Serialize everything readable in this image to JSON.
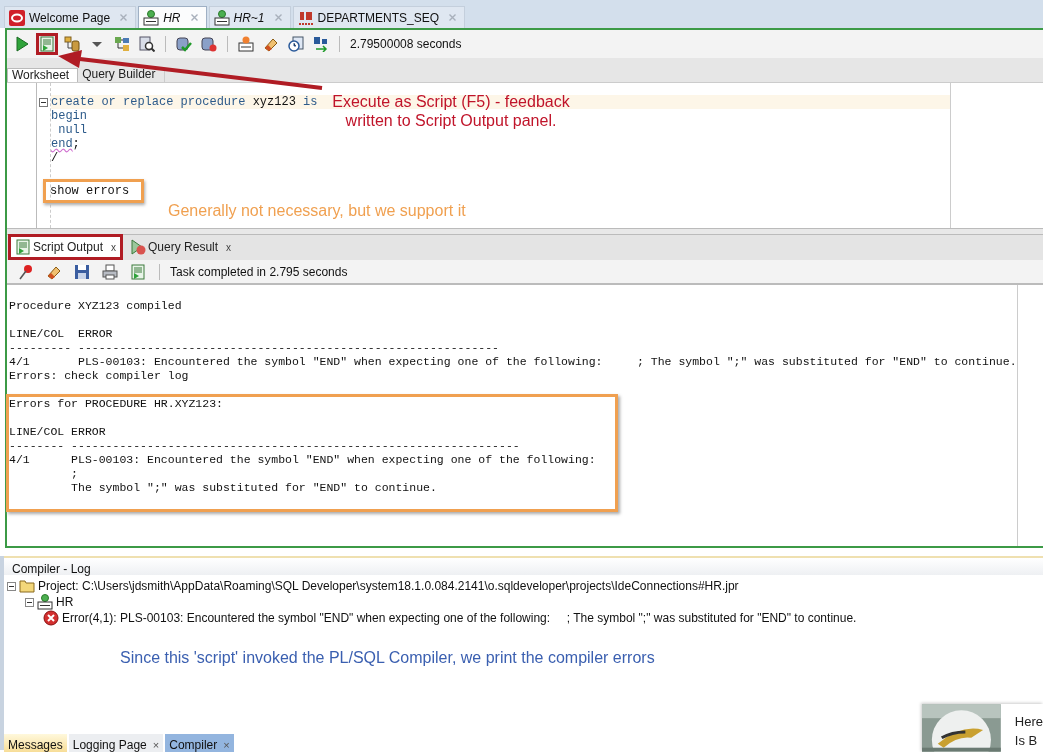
{
  "document_tabs": [
    {
      "label": "Welcome Page",
      "kind": "welcome",
      "italic": false,
      "selected": false
    },
    {
      "label": "HR",
      "kind": "worksheet",
      "italic": true,
      "selected": true
    },
    {
      "label": "HR~1",
      "kind": "worksheet",
      "italic": true,
      "selected": false
    },
    {
      "label": "DEPARTMENTS_SEQ",
      "kind": "sequence",
      "italic": false,
      "selected": false
    }
  ],
  "toolbar": {
    "groups": [
      [
        {
          "kind": "run",
          "highlighted": false
        },
        {
          "kind": "script",
          "highlighted": true
        },
        {
          "kind": "database",
          "highlighted": false
        },
        {
          "kind": "caret",
          "highlighted": false
        },
        {
          "kind": "tree",
          "highlighted": false
        },
        {
          "kind": "autotrace",
          "highlighted": false
        }
      ],
      [
        {
          "kind": "commit",
          "highlighted": false
        },
        {
          "kind": "rollback",
          "highlighted": false
        }
      ],
      [
        {
          "kind": "sqlfile",
          "highlighted": false
        },
        {
          "kind": "eraser",
          "highlighted": false
        },
        {
          "kind": "history",
          "highlighted": false
        },
        {
          "kind": "case",
          "highlighted": false
        }
      ]
    ],
    "elapsed": "2.79500008 seconds"
  },
  "editor_tabs": [
    {
      "label": "Worksheet",
      "selected": true
    },
    {
      "label": "Query Builder",
      "selected": false
    }
  ],
  "code_lines": [
    {
      "current": true,
      "highlighted": false,
      "segments": [
        {
          "text": "create or replace procedure ",
          "kind": "keyword"
        },
        {
          "text": "xyz123",
          "kind": "plain"
        },
        {
          "text": " is",
          "kind": "keyword"
        }
      ]
    },
    {
      "current": false,
      "highlighted": false,
      "segments": [
        {
          "text": "begin",
          "kind": "keyword"
        }
      ]
    },
    {
      "current": false,
      "highlighted": false,
      "segments": [
        {
          "text": " null",
          "kind": "keyword"
        }
      ]
    },
    {
      "current": false,
      "highlighted": false,
      "segments": [
        {
          "text": "end",
          "kind": "error"
        },
        {
          "text": ";",
          "kind": "plain"
        }
      ]
    },
    {
      "current": false,
      "highlighted": false,
      "segments": [
        {
          "text": "/",
          "kind": "plain"
        }
      ]
    },
    {
      "current": false,
      "highlighted": true,
      "segments": [
        {
          "text": "show errors",
          "kind": "plain"
        }
      ]
    }
  ],
  "callouts": [
    {
      "kind": "execute",
      "text": "Execute as Script (F5) - feedback\nwritten to Script Output panel.",
      "color": "#c0142a"
    },
    {
      "kind": "show",
      "text": "Generally not necessary, but we support it",
      "color": "#f0a050"
    },
    {
      "kind": "compiler",
      "text": "Since this 'script' invoked the PL/SQL Compiler, we print the compiler errors",
      "color": "#3a5fb0"
    }
  ],
  "output_tabs": [
    {
      "label": "Script Output",
      "kind": "script",
      "close": "x",
      "selected": true,
      "highlighted": true
    },
    {
      "label": "Query Result",
      "kind": "result",
      "close": "x",
      "selected": false,
      "highlighted": false
    }
  ],
  "output_toolbar": {
    "buttons": [
      {
        "kind": "pin"
      },
      {
        "kind": "eraser"
      },
      {
        "kind": "save"
      },
      {
        "kind": "print"
      },
      {
        "kind": "script"
      }
    ],
    "status": "Task completed in 2.795 seconds"
  },
  "output_sections": [
    {
      "highlighted": false,
      "paragraphs": [
        [
          "Procedure XYZ123 compiled"
        ],
        [
          "LINE/COL  ERROR",
          "--------- -------------------------------------------------------------",
          "4/1       PLS-00103: Encountered the symbol \"END\" when expecting one of the following:     ; The symbol \";\" was substituted for \"END\" to continue.",
          "Errors: check compiler log"
        ]
      ]
    },
    {
      "highlighted": true,
      "paragraphs": [
        [
          "Errors for PROCEDURE HR.XYZ123:"
        ],
        [
          "LINE/COL ERROR",
          "-------- -----------------------------------------------------------------",
          "4/1      PLS-00103: Encountered the symbol \"END\" when expecting one of the following:",
          "         ;",
          "         The symbol \";\" was substituted for \"END\" to continue."
        ]
      ]
    }
  ],
  "compiler_log": {
    "title": "Compiler - Log",
    "tree": [
      {
        "label": "Project: C:\\Users\\jdsmith\\AppData\\Roaming\\SQL Developer\\system18.1.0.084.2141\\o.sqldeveloper\\projects\\IdeConnections#HR.jpr",
        "kind": "project",
        "expanded": true,
        "children": [
          {
            "label": "HR",
            "kind": "connection",
            "expanded": true,
            "children": [
              {
                "label": "Error(4,1): PLS-00103: Encountered the symbol \"END\" when expecting one of the following:     ; The symbol \";\" was substituted for \"END\" to continue.",
                "kind": "error"
              }
            ]
          }
        ]
      }
    ]
  },
  "bottom_tabs": [
    {
      "label": "Messages",
      "highlighted": true,
      "selected": false
    },
    {
      "label": "Logging Page",
      "close": "×",
      "highlighted": false,
      "selected": false
    },
    {
      "label": "Compiler",
      "close": "×",
      "highlighted": false,
      "selected": true
    }
  ],
  "notification": {
    "lines": [
      "Here",
      "Is B"
    ]
  }
}
